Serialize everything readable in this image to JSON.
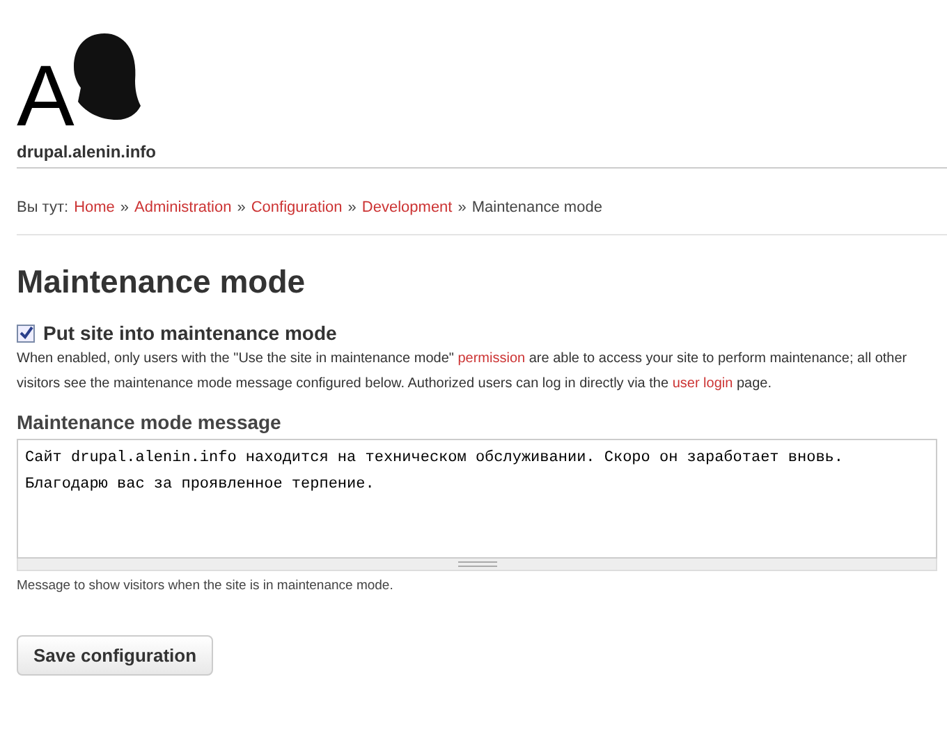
{
  "header": {
    "logo_letter": "A",
    "site_name": "drupal.alenin.info"
  },
  "breadcrumb": {
    "prefix": "Вы тут:",
    "separator": "»",
    "items": [
      {
        "label": "Home",
        "kind": "link"
      },
      {
        "label": "Administration",
        "kind": "link"
      },
      {
        "label": "Configuration",
        "kind": "link"
      },
      {
        "label": "Development",
        "kind": "link"
      },
      {
        "label": "Maintenance mode",
        "kind": "current"
      }
    ]
  },
  "page_title": "Maintenance mode",
  "maintenance_checkbox": {
    "label": "Put site into maintenance mode",
    "checked": true,
    "description": [
      {
        "kind": "text",
        "text": "When enabled, only users with the \"Use the site in maintenance mode\" "
      },
      {
        "kind": "link",
        "text": "permission"
      },
      {
        "kind": "text",
        "text": " are able to access your site to perform maintenance; all other visitors see the maintenance mode message configured below. Authorized users can log in directly via the "
      },
      {
        "kind": "link",
        "text": "user login"
      },
      {
        "kind": "text",
        "text": " page."
      }
    ]
  },
  "message_field": {
    "label": "Maintenance mode message",
    "value": "Сайт drupal.alenin.info находится на техническом обслуживании. Скоро он заработает вновь.\nБлагодарю вас за проявленное терпение.",
    "help": "Message to show visitors when the site is in maintenance mode."
  },
  "buttons": [
    "Save configuration"
  ]
}
